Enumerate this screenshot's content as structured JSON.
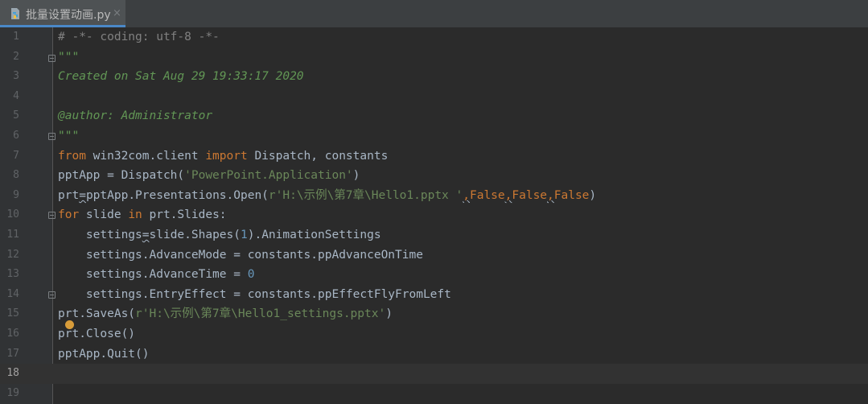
{
  "tab": {
    "title": "批量设置动画.py",
    "close": "×"
  },
  "gutter": {
    "line_numbers": [
      "1",
      "2",
      "3",
      "4",
      "5",
      "6",
      "7",
      "8",
      "9",
      "10",
      "11",
      "12",
      "13",
      "14",
      "15",
      "16",
      "17",
      "18",
      "19"
    ],
    "current_line": "18"
  },
  "code": {
    "l1": "# -*- coding: utf-8 -*-",
    "l2": "\"\"\"",
    "l3": "Created on Sat Aug 29 19:33:17 2020",
    "l5": "@author: Administrator",
    "l6": "\"\"\"",
    "l7": {
      "from": "from",
      "mod": " win32com.client ",
      "import": "import",
      "rest": " Dispatch, constants"
    },
    "l8": {
      "a": "pptApp = Dispatch(",
      "s": "'PowerPoint.Application'",
      "b": ")"
    },
    "l9": {
      "a": "prt",
      "eq": "=",
      "b": "pptApp.Presentations.Open(",
      "s": "r'H:\\示例\\第7章\\Hello1.pptx '",
      "c1": ",",
      "f1": "False",
      "c2": ",",
      "f2": "False",
      "c3": ",",
      "f3": "False",
      "close": ")"
    },
    "l10": {
      "for": "for",
      "a": " slide ",
      "in": "in",
      "b": " prt.Slides:"
    },
    "l11": {
      "indent": "    ",
      "a": "settings",
      "eq": "=",
      "b": "slide.Shapes(",
      "n": "1",
      "c": ").AnimationSettings"
    },
    "l12": "    settings.AdvanceMode = constants.ppAdvanceOnTime",
    "l13": {
      "a": "    settings.AdvanceTime = ",
      "n": "0"
    },
    "l14": "    settings.EntryEffect = constants.ppEffectFlyFromLeft",
    "l15": {
      "a": "prt.SaveAs(",
      "s": "r'H:\\示例\\第7章\\Hello1_settings.pptx'",
      "b": ")"
    },
    "l16": "prt.Close()",
    "l17": {
      "a": "p",
      "b": "p",
      "c": "tApp.Quit()"
    }
  },
  "colors": {
    "background": "#2b2b2b",
    "keyword": "#cc7832",
    "string": "#6a8759",
    "docstring": "#629755",
    "comment": "#808080",
    "number": "#6897bb",
    "text": "#a9b7c6",
    "intention_bulb": "#d89c3a"
  },
  "icons": [
    "python-file-icon",
    "close-icon",
    "fold-marker-icon",
    "intention-bulb-icon"
  ]
}
